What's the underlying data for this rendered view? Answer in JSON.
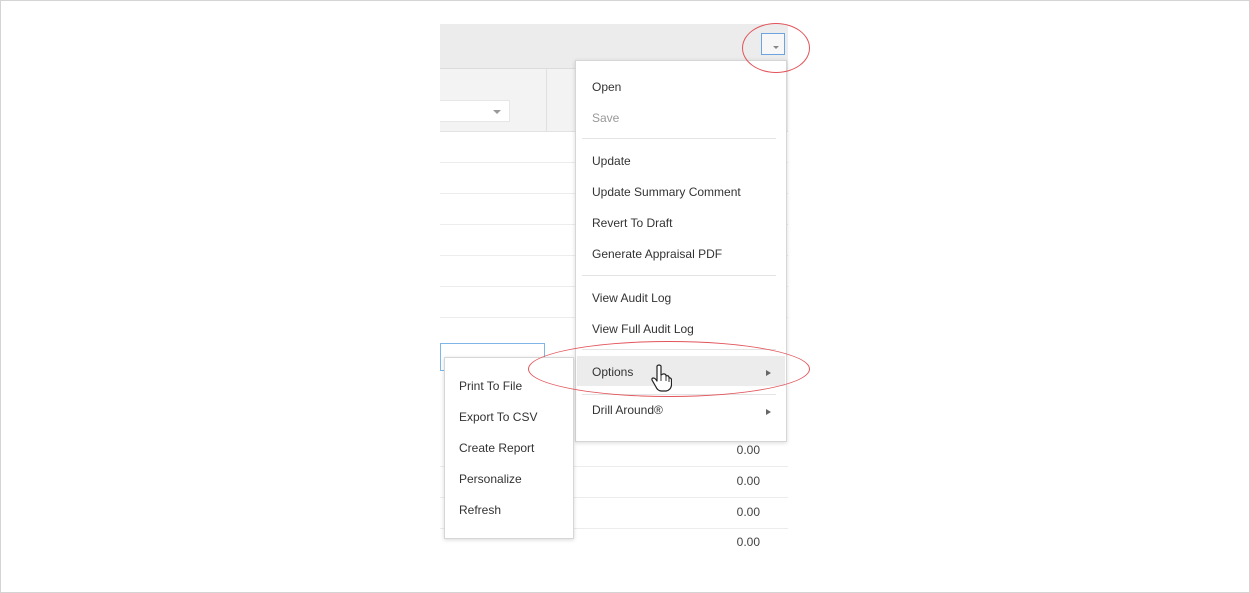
{
  "context_menu": {
    "items": [
      {
        "label": "Open",
        "disabled": false
      },
      {
        "label": "Save",
        "disabled": true
      },
      {
        "label": "Update",
        "disabled": false
      },
      {
        "label": "Update Summary Comment",
        "disabled": false
      },
      {
        "label": "Revert To Draft",
        "disabled": false
      },
      {
        "label": "Generate Appraisal PDF",
        "disabled": false
      },
      {
        "label": "View Audit Log",
        "disabled": false
      },
      {
        "label": "View Full Audit Log",
        "disabled": false
      },
      {
        "label": "Options",
        "disabled": false,
        "has_submenu": true,
        "highlighted": true
      },
      {
        "label": "Drill Around®",
        "disabled": false,
        "has_submenu": true
      }
    ]
  },
  "options_submenu": {
    "items": [
      "Print To File",
      "Export To CSV",
      "Create Report",
      "Personalize",
      "Refresh"
    ]
  },
  "grid": {
    "values": [
      "0.00",
      "0.00",
      "0.00",
      "0.00"
    ]
  },
  "icons": {
    "menu_trigger": "dropdown-menu-icon",
    "submenu_arrow": "arrow-right-icon",
    "cursor": "hand-pointer-icon"
  },
  "colors": {
    "annotation": "#e2555b",
    "focus_border": "#6aa5e0",
    "menu_highlight": "#ececec"
  }
}
